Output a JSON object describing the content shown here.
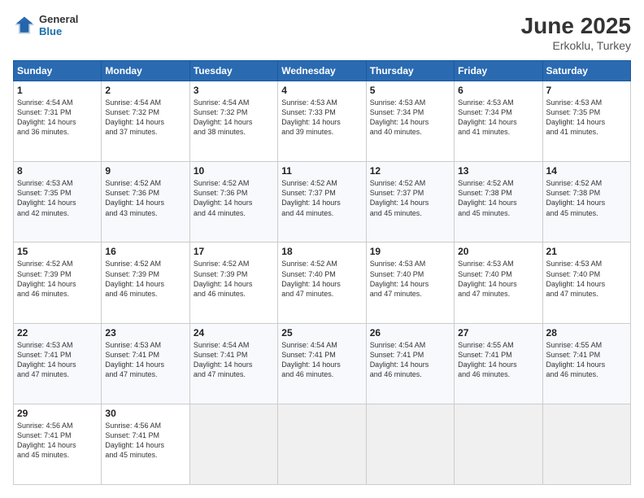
{
  "header": {
    "logo_general": "General",
    "logo_blue": "Blue",
    "title": "June 2025",
    "location": "Erkoklu, Turkey"
  },
  "weekdays": [
    "Sunday",
    "Monday",
    "Tuesday",
    "Wednesday",
    "Thursday",
    "Friday",
    "Saturday"
  ],
  "weeks": [
    [
      {
        "day": "1",
        "lines": [
          "Sunrise: 4:54 AM",
          "Sunset: 7:31 PM",
          "Daylight: 14 hours",
          "and 36 minutes."
        ]
      },
      {
        "day": "2",
        "lines": [
          "Sunrise: 4:54 AM",
          "Sunset: 7:32 PM",
          "Daylight: 14 hours",
          "and 37 minutes."
        ]
      },
      {
        "day": "3",
        "lines": [
          "Sunrise: 4:54 AM",
          "Sunset: 7:32 PM",
          "Daylight: 14 hours",
          "and 38 minutes."
        ]
      },
      {
        "day": "4",
        "lines": [
          "Sunrise: 4:53 AM",
          "Sunset: 7:33 PM",
          "Daylight: 14 hours",
          "and 39 minutes."
        ]
      },
      {
        "day": "5",
        "lines": [
          "Sunrise: 4:53 AM",
          "Sunset: 7:34 PM",
          "Daylight: 14 hours",
          "and 40 minutes."
        ]
      },
      {
        "day": "6",
        "lines": [
          "Sunrise: 4:53 AM",
          "Sunset: 7:34 PM",
          "Daylight: 14 hours",
          "and 41 minutes."
        ]
      },
      {
        "day": "7",
        "lines": [
          "Sunrise: 4:53 AM",
          "Sunset: 7:35 PM",
          "Daylight: 14 hours",
          "and 41 minutes."
        ]
      }
    ],
    [
      {
        "day": "8",
        "lines": [
          "Sunrise: 4:53 AM",
          "Sunset: 7:35 PM",
          "Daylight: 14 hours",
          "and 42 minutes."
        ]
      },
      {
        "day": "9",
        "lines": [
          "Sunrise: 4:52 AM",
          "Sunset: 7:36 PM",
          "Daylight: 14 hours",
          "and 43 minutes."
        ]
      },
      {
        "day": "10",
        "lines": [
          "Sunrise: 4:52 AM",
          "Sunset: 7:36 PM",
          "Daylight: 14 hours",
          "and 44 minutes."
        ]
      },
      {
        "day": "11",
        "lines": [
          "Sunrise: 4:52 AM",
          "Sunset: 7:37 PM",
          "Daylight: 14 hours",
          "and 44 minutes."
        ]
      },
      {
        "day": "12",
        "lines": [
          "Sunrise: 4:52 AM",
          "Sunset: 7:37 PM",
          "Daylight: 14 hours",
          "and 45 minutes."
        ]
      },
      {
        "day": "13",
        "lines": [
          "Sunrise: 4:52 AM",
          "Sunset: 7:38 PM",
          "Daylight: 14 hours",
          "and 45 minutes."
        ]
      },
      {
        "day": "14",
        "lines": [
          "Sunrise: 4:52 AM",
          "Sunset: 7:38 PM",
          "Daylight: 14 hours",
          "and 45 minutes."
        ]
      }
    ],
    [
      {
        "day": "15",
        "lines": [
          "Sunrise: 4:52 AM",
          "Sunset: 7:39 PM",
          "Daylight: 14 hours",
          "and 46 minutes."
        ]
      },
      {
        "day": "16",
        "lines": [
          "Sunrise: 4:52 AM",
          "Sunset: 7:39 PM",
          "Daylight: 14 hours",
          "and 46 minutes."
        ]
      },
      {
        "day": "17",
        "lines": [
          "Sunrise: 4:52 AM",
          "Sunset: 7:39 PM",
          "Daylight: 14 hours",
          "and 46 minutes."
        ]
      },
      {
        "day": "18",
        "lines": [
          "Sunrise: 4:52 AM",
          "Sunset: 7:40 PM",
          "Daylight: 14 hours",
          "and 47 minutes."
        ]
      },
      {
        "day": "19",
        "lines": [
          "Sunrise: 4:53 AM",
          "Sunset: 7:40 PM",
          "Daylight: 14 hours",
          "and 47 minutes."
        ]
      },
      {
        "day": "20",
        "lines": [
          "Sunrise: 4:53 AM",
          "Sunset: 7:40 PM",
          "Daylight: 14 hours",
          "and 47 minutes."
        ]
      },
      {
        "day": "21",
        "lines": [
          "Sunrise: 4:53 AM",
          "Sunset: 7:40 PM",
          "Daylight: 14 hours",
          "and 47 minutes."
        ]
      }
    ],
    [
      {
        "day": "22",
        "lines": [
          "Sunrise: 4:53 AM",
          "Sunset: 7:41 PM",
          "Daylight: 14 hours",
          "and 47 minutes."
        ]
      },
      {
        "day": "23",
        "lines": [
          "Sunrise: 4:53 AM",
          "Sunset: 7:41 PM",
          "Daylight: 14 hours",
          "and 47 minutes."
        ]
      },
      {
        "day": "24",
        "lines": [
          "Sunrise: 4:54 AM",
          "Sunset: 7:41 PM",
          "Daylight: 14 hours",
          "and 47 minutes."
        ]
      },
      {
        "day": "25",
        "lines": [
          "Sunrise: 4:54 AM",
          "Sunset: 7:41 PM",
          "Daylight: 14 hours",
          "and 46 minutes."
        ]
      },
      {
        "day": "26",
        "lines": [
          "Sunrise: 4:54 AM",
          "Sunset: 7:41 PM",
          "Daylight: 14 hours",
          "and 46 minutes."
        ]
      },
      {
        "day": "27",
        "lines": [
          "Sunrise: 4:55 AM",
          "Sunset: 7:41 PM",
          "Daylight: 14 hours",
          "and 46 minutes."
        ]
      },
      {
        "day": "28",
        "lines": [
          "Sunrise: 4:55 AM",
          "Sunset: 7:41 PM",
          "Daylight: 14 hours",
          "and 46 minutes."
        ]
      }
    ],
    [
      {
        "day": "29",
        "lines": [
          "Sunrise: 4:56 AM",
          "Sunset: 7:41 PM",
          "Daylight: 14 hours",
          "and 45 minutes."
        ]
      },
      {
        "day": "30",
        "lines": [
          "Sunrise: 4:56 AM",
          "Sunset: 7:41 PM",
          "Daylight: 14 hours",
          "and 45 minutes."
        ]
      },
      {
        "day": "",
        "lines": []
      },
      {
        "day": "",
        "lines": []
      },
      {
        "day": "",
        "lines": []
      },
      {
        "day": "",
        "lines": []
      },
      {
        "day": "",
        "lines": []
      }
    ]
  ]
}
